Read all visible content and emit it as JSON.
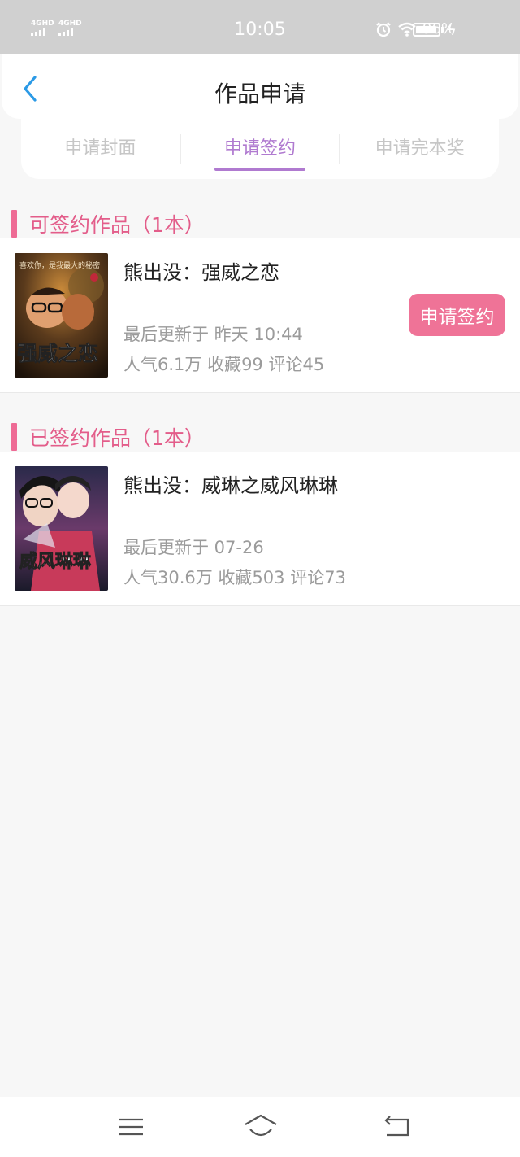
{
  "status_bar": {
    "signal_1": "4GHD",
    "signal_2": "4GHD",
    "time": "10:05",
    "battery": "96%",
    "battery_level": 0.96,
    "icons": [
      "alarm-icon",
      "wifi-icon",
      "battery-icon",
      "charging-icon"
    ]
  },
  "header": {
    "title": "作品申请",
    "back_icon": "chevron-left-icon"
  },
  "tabs": [
    {
      "label": "申请封面",
      "active": false
    },
    {
      "label": "申请签约",
      "active": true
    },
    {
      "label": "申请完本奖",
      "active": false
    }
  ],
  "sections": [
    {
      "title": "可签约作品（1本）",
      "books": [
        {
          "title": "熊出没：强威之恋",
          "updated": "最后更新于 昨天 10:44",
          "stats": "人气6.1万 收藏99 评论45",
          "cover_text": "强威之恋",
          "cover_small_text": "喜欢你，是我最大的秘密",
          "action": "申请签约"
        }
      ]
    },
    {
      "title": "已签约作品（1本）",
      "books": [
        {
          "title": "熊出没：威琳之威风琳琳",
          "updated": "最后更新于 07-26",
          "stats": "人气30.6万 收藏503 评论73",
          "cover_text": "威风琳琳"
        }
      ]
    }
  ],
  "colors": {
    "accent_pink": "#ef7397",
    "section_pink": "#e35d8a",
    "tab_active": "#b07ad0",
    "back_blue": "#2b9ae6"
  },
  "bottom_nav": [
    "menu-icon",
    "home-icon",
    "back-icon"
  ]
}
